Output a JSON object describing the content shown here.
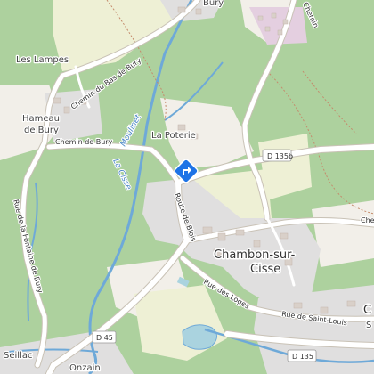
{
  "map": {
    "places": {
      "bury": "Bury",
      "les_lampes": "Les Lampes",
      "hameau_line1": "Hameau",
      "hameau_line2": "de Bury",
      "la_poterie": "La Poterie",
      "chambon_line1": "Chambon-sur-",
      "chambon_line2": "Cisse",
      "seillac": "Seillac",
      "onzain": "Onzain",
      "edge_c": "C",
      "edge_s": "S"
    },
    "roads": {
      "chemin_bas_bury": "Chemin du Bas de Bury",
      "chemin_de_bury": "Chemin de Bury",
      "route_de_blois": "Route de Blois",
      "rue_fontaine_bury": "Rue de la Fontaine de Bury",
      "rue_des_loges": "Rue des Loges",
      "rue_saint_louis": "Rue de Saint-Louis",
      "chemin_top": "Chemin",
      "chem_right": "Chem"
    },
    "road_refs": {
      "d135b": "D 135b",
      "d45": "D 45",
      "d135": "D 135"
    },
    "waterways": {
      "la_cisse": "La Cisse",
      "moulinet": "Moulinet"
    },
    "colors": {
      "forest": "#add19e",
      "open_land": "#f2efe9",
      "farmland": "#eef0d5",
      "residential": "#e0dfdf",
      "water": "#aad3df",
      "stream": "#6ea9d8",
      "road": "#ffffff",
      "road_casing": "#c9c2b6",
      "marker": "#1e73e6"
    },
    "marker_icon": "directions-icon"
  }
}
